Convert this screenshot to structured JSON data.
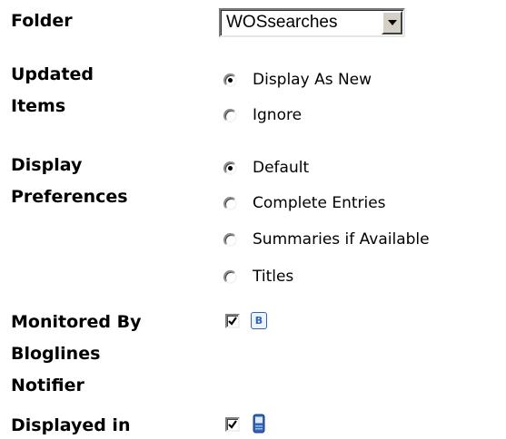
{
  "folder": {
    "label": "Folder",
    "selected": "WOSsearches"
  },
  "updated_items": {
    "label_line1": "Updated",
    "label_line2": "Items",
    "options": [
      {
        "label": "Display As New",
        "checked": true
      },
      {
        "label": "Ignore",
        "checked": false
      }
    ]
  },
  "display_preferences": {
    "label_line1": "Display",
    "label_line2": "Preferences",
    "options": [
      {
        "label": "Default",
        "checked": true
      },
      {
        "label": "Complete Entries",
        "checked": false
      },
      {
        "label": "Summaries if Available",
        "checked": false
      },
      {
        "label": "Titles",
        "checked": false
      }
    ]
  },
  "monitored": {
    "label_line1": "Monitored By",
    "label_line2": "Bloglines",
    "label_line3": "Notifier",
    "checked": true,
    "icon": "bloglines-notifier-icon",
    "icon_glyph": "B"
  },
  "displayed_in": {
    "label_line1": "Displayed in",
    "checked": true,
    "icon": "mobile-phone-icon"
  },
  "colors": {
    "icon_blue": "#2f63b6",
    "control_face": "#d4d0c8"
  }
}
